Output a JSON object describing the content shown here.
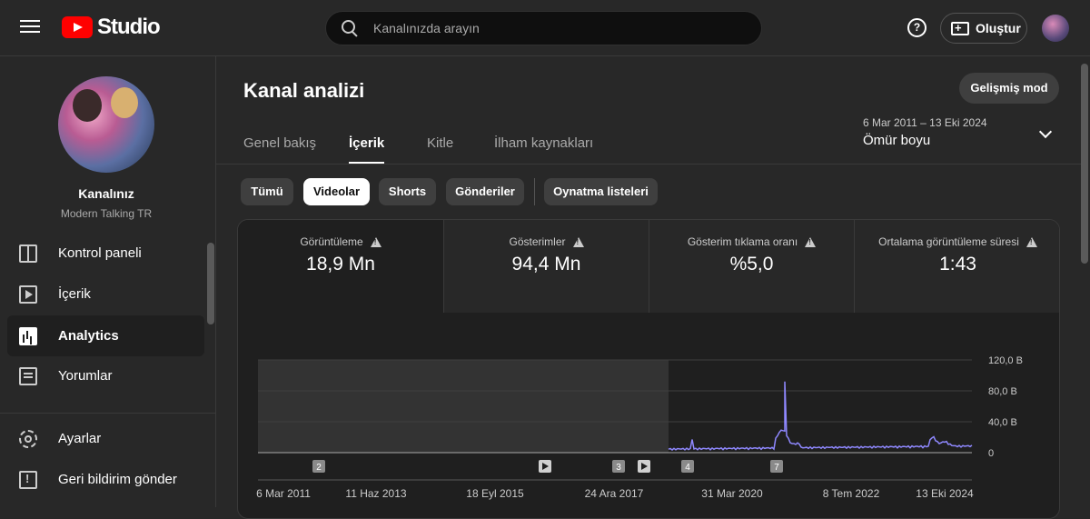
{
  "header": {
    "logo_text": "Studio",
    "search_placeholder": "Kanalınızda arayın",
    "help_label": "?",
    "create_label": "Oluştur"
  },
  "sidebar": {
    "channel_name": "Kanalınız",
    "channel_handle": "Modern Talking TR",
    "items": [
      {
        "label": "Kontrol paneli",
        "icon": "dashboard-icon"
      },
      {
        "label": "İçerik",
        "icon": "content-icon"
      },
      {
        "label": "Analytics",
        "icon": "analytics-icon"
      },
      {
        "label": "Yorumlar",
        "icon": "comments-icon"
      }
    ],
    "bottom_items": [
      {
        "label": "Ayarlar",
        "icon": "gear-icon"
      },
      {
        "label": "Geri bildirim gönder",
        "icon": "feedback-icon"
      }
    ],
    "active_item": "Analytics"
  },
  "main": {
    "title": "Kanal analizi",
    "advanced_mode": "Gelişmiş mod",
    "tabs": [
      "Genel bakış",
      "İçerik",
      "Kitle",
      "İlham kaynakları"
    ],
    "active_tab": "İçerik",
    "date_range": "6 Mar 2011 – 13 Eki 2024",
    "period": "Ömür boyu",
    "chips": [
      "Tümü",
      "Videolar",
      "Shorts",
      "Gönderiler",
      "Oynatma listeleri"
    ],
    "active_chip": "Videolar",
    "metrics": [
      {
        "label": "Görüntüleme",
        "value": "18,9 Mn"
      },
      {
        "label": "Gösterimler",
        "value": "94,4 Mn"
      },
      {
        "label": "Gösterim tıklama oranı",
        "value": "%5,0"
      },
      {
        "label": "Ortalama görüntüleme süresi",
        "value": "1:43"
      }
    ]
  },
  "chart_data": {
    "type": "line",
    "series": [
      {
        "values_note": "daily views"
      }
    ],
    "x_ticks": [
      "6 Mar 2011",
      "11 Haz 2013",
      "18 Eyl 2015",
      "24 Ara 2017",
      "31 Mar 2020",
      "8 Tem 2022",
      "13 Eki 2024"
    ],
    "y_ticks": [
      "120,0 B",
      "80,0 B",
      "40,0 B",
      "0"
    ],
    "ylim": [
      0,
      120000
    ],
    "markers": [
      "2",
      "play",
      "3",
      "play",
      "4",
      "7"
    ],
    "line_color": "#8f88ff",
    "shaded_region_end": "31 Mar 2019"
  }
}
